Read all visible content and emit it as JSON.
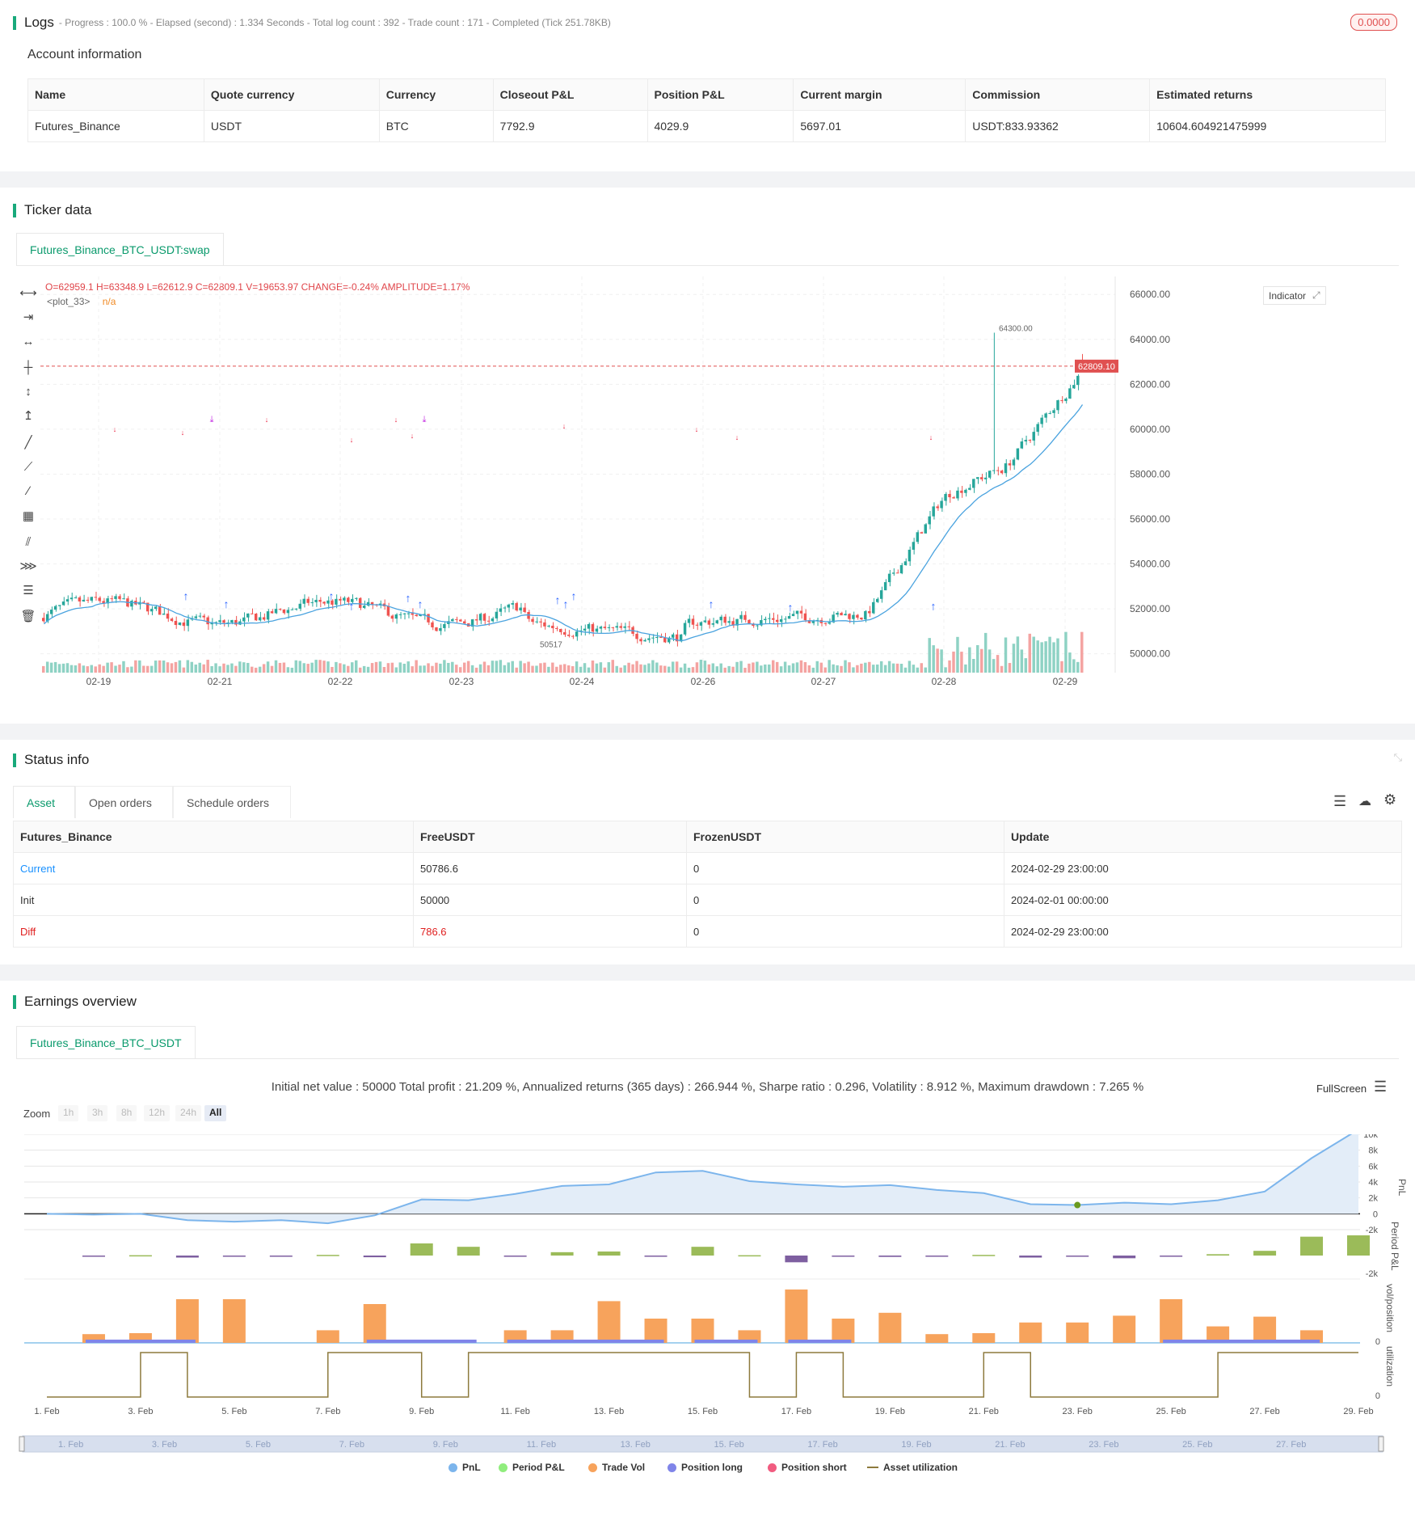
{
  "logs": {
    "title": "Logs",
    "meta": "- Progress : 100.0 % - Elapsed (second) : 1.334  Seconds - Total log count : 392 - Trade count : 171 - Completed (Tick 251.78KB)",
    "badge": "0.0000"
  },
  "account": {
    "subtitle": "Account information",
    "headers": [
      "Name",
      "Quote currency",
      "Currency",
      "Closeout P&L",
      "Position P&L",
      "Current margin",
      "Commission",
      "Estimated returns"
    ],
    "row": [
      "Futures_Binance",
      "USDT",
      "BTC",
      "7792.9",
      "4029.9",
      "5697.01",
      "USDT:833.93362",
      "10604.604921475999"
    ]
  },
  "ticker": {
    "title": "Ticker data",
    "tab": "Futures_Binance_BTC_USDT:swap",
    "ohlc": "O=62959.1 H=63348.9 L=62612.9 C=62809.1 V=19653.97 CHANGE=-0.24% AMPLITUDE=1.17%",
    "plot_label": "<plot_33>",
    "plot_value": "n/a",
    "indicator_btn": "Indicator",
    "price_ticks": [
      "66000.00",
      "64000.00",
      "62000.00",
      "60000.00",
      "58000.00",
      "56000.00",
      "54000.00",
      "52000.00",
      "50000.00"
    ],
    "current_price": "62809.10",
    "high_label": "64300.00",
    "low_label": "50517",
    "date_ticks": [
      "02-19",
      "02-21",
      "02-22",
      "02-23",
      "02-24",
      "02-26",
      "02-27",
      "02-28",
      "02-29"
    ],
    "colors": {
      "up": "#26a69a",
      "down": "#ef5350",
      "ma": "#4aa3df",
      "signal_long": "#2962ff",
      "signal_short": "#e91e3c",
      "signal_close": "#c020e0"
    }
  },
  "status": {
    "title": "Status info",
    "tabs": [
      "Asset",
      "Open orders",
      "Schedule orders"
    ],
    "headers": [
      "Futures_Binance",
      "FreeUSDT",
      "FrozenUSDT",
      "Update"
    ],
    "rows": [
      [
        "Current",
        "50786.6",
        "0",
        "2024-02-29 23:00:00"
      ],
      [
        "Init",
        "50000",
        "0",
        "2024-02-01 00:00:00"
      ],
      [
        "Diff",
        "786.6",
        "0",
        "2024-02-29 23:00:00"
      ]
    ]
  },
  "earnings": {
    "title": "Earnings overview",
    "tab": "Futures_Binance_BTC_USDT",
    "summary": "Initial net value : 50000 Total profit : 21.209 %, Annualized returns (365 days) : 266.944 %, Sharpe ratio : 0.296, Volatility : 8.912 %, Maximum drawdown : 7.265 %",
    "fullscreen": "FullScreen",
    "zoom_label": "Zoom",
    "zoom_buttons": [
      "1h",
      "3h",
      "8h",
      "12h",
      "24h",
      "All"
    ],
    "pnl_ticks": [
      "10k",
      "8k",
      "6k",
      "4k",
      "2k",
      "0",
      "-2k"
    ],
    "pnl_axis": "PnL",
    "period_axis": "Period P&L",
    "period_tick": "-2k",
    "vol_axis": "vol/position",
    "vol_tick": "0",
    "util_axis": "utilization",
    "util_tick": "0",
    "date_ticks": [
      "1. Feb",
      "3. Feb",
      "5. Feb",
      "7. Feb",
      "9. Feb",
      "11. Feb",
      "13. Feb",
      "15. Feb",
      "17. Feb",
      "19. Feb",
      "21. Feb",
      "23. Feb",
      "25. Feb",
      "27. Feb",
      "29. Feb"
    ],
    "nav_ticks": [
      "1. Feb",
      "3. Feb",
      "5. Feb",
      "7. Feb",
      "9. Feb",
      "11. Feb",
      "13. Feb",
      "15. Feb",
      "17. Feb",
      "19. Feb",
      "21. Feb",
      "23. Feb",
      "25. Feb",
      "27. Feb"
    ],
    "legend": [
      {
        "label": "PnL",
        "color": "#7cb5ec"
      },
      {
        "label": "Period P&L",
        "color": "#90ed7d"
      },
      {
        "label": "Trade Vol",
        "color": "#f7a35c"
      },
      {
        "label": "Position long",
        "color": "#8085e9"
      },
      {
        "label": "Position short",
        "color": "#f15c80"
      },
      {
        "label": "Asset utilization",
        "color": "#8d7a3d"
      }
    ]
  },
  "chart_data": {
    "type": "line",
    "title": "",
    "x": [
      "1. Feb",
      "2. Feb",
      "3. Feb",
      "4. Feb",
      "5. Feb",
      "6. Feb",
      "7. Feb",
      "8. Feb",
      "9. Feb",
      "10. Feb",
      "11. Feb",
      "12. Feb",
      "13. Feb",
      "14. Feb",
      "15. Feb",
      "16. Feb",
      "17. Feb",
      "18. Feb",
      "19. Feb",
      "20. Feb",
      "21. Feb",
      "22. Feb",
      "23. Feb",
      "24. Feb",
      "25. Feb",
      "26. Feb",
      "27. Feb",
      "28. Feb",
      "29. Feb"
    ],
    "series": [
      {
        "name": "PnL",
        "values": [
          0,
          -100,
          0,
          -800,
          -1000,
          -800,
          -1200,
          -200,
          1800,
          1700,
          2500,
          3500,
          3700,
          5200,
          5400,
          4100,
          3700,
          3400,
          3600,
          3000,
          2600,
          1200,
          1100,
          1400,
          1200,
          1700,
          2800,
          7000,
          10600
        ]
      },
      {
        "name": "Period P&L",
        "values": [
          0,
          -150,
          50,
          -300,
          -150,
          -100,
          100,
          -250,
          1800,
          1300,
          -50,
          500,
          600,
          -100,
          1300,
          50,
          -1000,
          -100,
          -200,
          -100,
          100,
          -300,
          -100,
          -400,
          -50,
          200,
          700,
          2800,
          3000
        ]
      },
      {
        "name": "Trade Vol",
        "values": [
          0,
          9,
          10,
          45,
          45,
          0,
          13,
          40,
          0,
          0,
          13,
          13,
          43,
          25,
          25,
          13,
          55,
          25,
          31,
          9,
          10,
          21,
          21,
          28,
          45,
          17,
          27,
          13,
          0
        ]
      },
      {
        "name": "Asset utilization",
        "values": [
          0,
          0,
          1,
          0,
          0,
          0,
          1,
          1,
          0,
          1,
          1,
          1,
          1,
          1,
          1,
          0,
          1,
          0,
          0,
          0,
          1,
          0,
          0,
          0,
          0,
          1,
          1,
          1,
          1
        ]
      }
    ],
    "ylim": [
      -2000,
      10000
    ]
  }
}
